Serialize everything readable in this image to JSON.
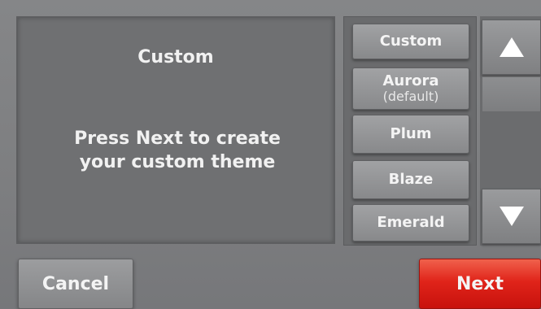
{
  "preview": {
    "title": "Custom",
    "message_line1": "Press Next to create",
    "message_line2": "your custom theme"
  },
  "themes": [
    {
      "label": "Custom"
    },
    {
      "label": "Aurora",
      "sublabel": "(default)"
    },
    {
      "label": "Plum"
    },
    {
      "label": "Blaze"
    },
    {
      "label": "Emerald"
    }
  ],
  "scroll": {
    "up_icon": "triangle-up-icon",
    "down_icon": "triangle-down-icon"
  },
  "actions": {
    "cancel_label": "Cancel",
    "next_label": "Next"
  },
  "colors": {
    "next_accent": "#e0241a",
    "background": "#7d7e80"
  }
}
